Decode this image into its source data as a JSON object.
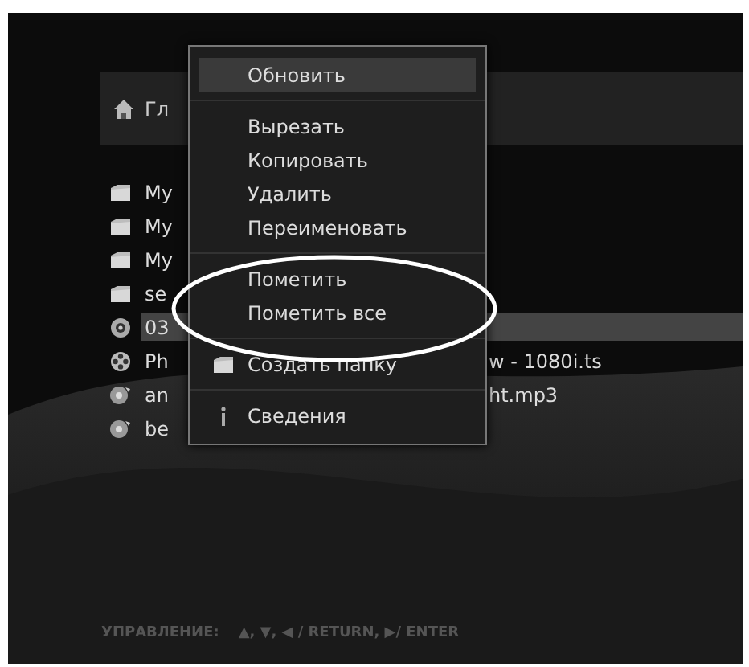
{
  "header": {
    "title": "Гл"
  },
  "files": [
    {
      "kind": "folder",
      "name": "My",
      "selected": false
    },
    {
      "kind": "folder",
      "name": "My",
      "selected": false
    },
    {
      "kind": "folder",
      "name": "My",
      "selected": false
    },
    {
      "kind": "folder",
      "name": "se",
      "selected": false
    },
    {
      "kind": "disc",
      "name": "03",
      "selected": true
    },
    {
      "kind": "video",
      "name": "Ph",
      "tail": "w - 1080i.ts",
      "selected": false
    },
    {
      "kind": "audio",
      "name": "an",
      "tail": "ht.mp3",
      "selected": false
    },
    {
      "kind": "audio",
      "name": "be",
      "selected": false
    }
  ],
  "context_menu": {
    "groups": [
      {
        "items": [
          {
            "label": "Обновить",
            "selected": true
          }
        ]
      },
      {
        "items": [
          {
            "label": "Вырезать",
            "selected": false
          },
          {
            "label": "Копировать",
            "selected": false
          },
          {
            "label": "Удалить",
            "selected": false
          },
          {
            "label": "Переименовать",
            "selected": false
          }
        ]
      },
      {
        "items": [
          {
            "label": "Пометить",
            "selected": false
          },
          {
            "label": "Пометить все",
            "selected": false
          }
        ]
      },
      {
        "items": [
          {
            "label": "Создать папку",
            "kind": "folder",
            "selected": false
          }
        ]
      },
      {
        "items": [
          {
            "label": "Сведения",
            "kind": "info",
            "selected": false
          }
        ]
      }
    ]
  },
  "footer": {
    "label": "УПРАВЛЕНИЕ:",
    "keys": "▲, ▼, ◀ / RETURN, ▶/ ENTER"
  }
}
